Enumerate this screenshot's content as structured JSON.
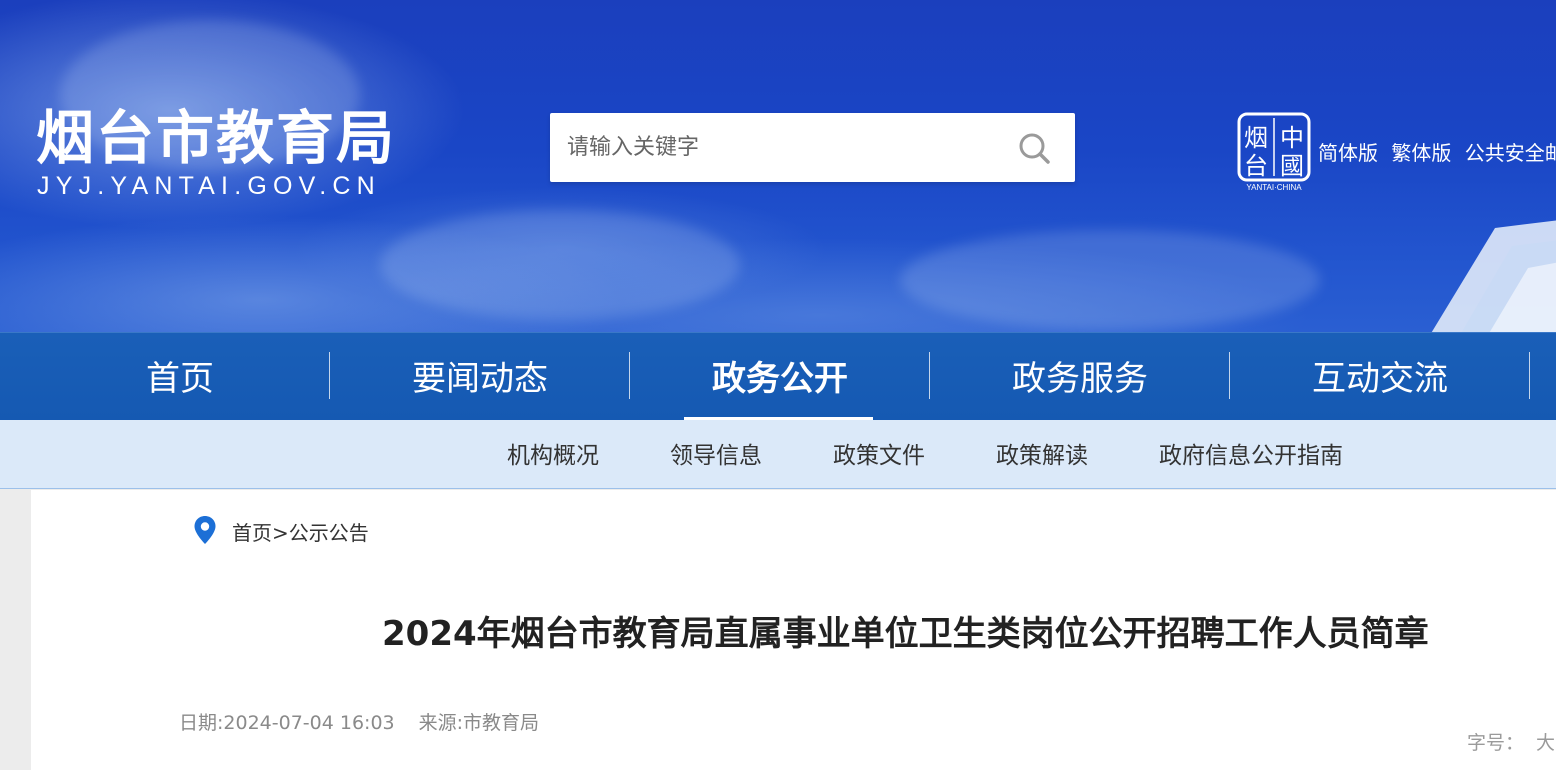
{
  "header": {
    "site_title": "烟台市教育局",
    "site_domain": "JYJ.YANTAI.GOV.CN",
    "search": {
      "placeholder": "请输入关键字"
    },
    "seal": {
      "chars": [
        "烟",
        "中",
        "台",
        "國"
      ],
      "caption": "YANTAI·CHINA"
    },
    "top_links": [
      "简体版",
      "繁体版",
      "公共安全邮"
    ]
  },
  "main_nav": {
    "items": [
      {
        "label": "首页",
        "active": false
      },
      {
        "label": "要闻动态",
        "active": false
      },
      {
        "label": "政务公开",
        "active": true
      },
      {
        "label": "政务服务",
        "active": false
      },
      {
        "label": "互动交流",
        "active": false
      }
    ]
  },
  "sub_nav": {
    "items": [
      "机构概况",
      "领导信息",
      "政策文件",
      "政策解读",
      "政府信息公开指南"
    ]
  },
  "breadcrumb": {
    "home": "首页",
    "separator": ">",
    "section": "公示公告"
  },
  "article": {
    "title": "2024年烟台市教育局直属事业单位卫生类岗位公开招聘工作人员简章",
    "date_label": "日期:",
    "date": "2024-07-04 16:03",
    "source_label": "来源:",
    "source": "市教育局",
    "font_size_label": "字号：",
    "font_size_option": "大"
  },
  "colors": {
    "header_blue": "#1a46c6",
    "nav_blue": "#1559b2",
    "subnav_bg": "#dbe9f9",
    "location_icon": "#1c6fd6"
  }
}
